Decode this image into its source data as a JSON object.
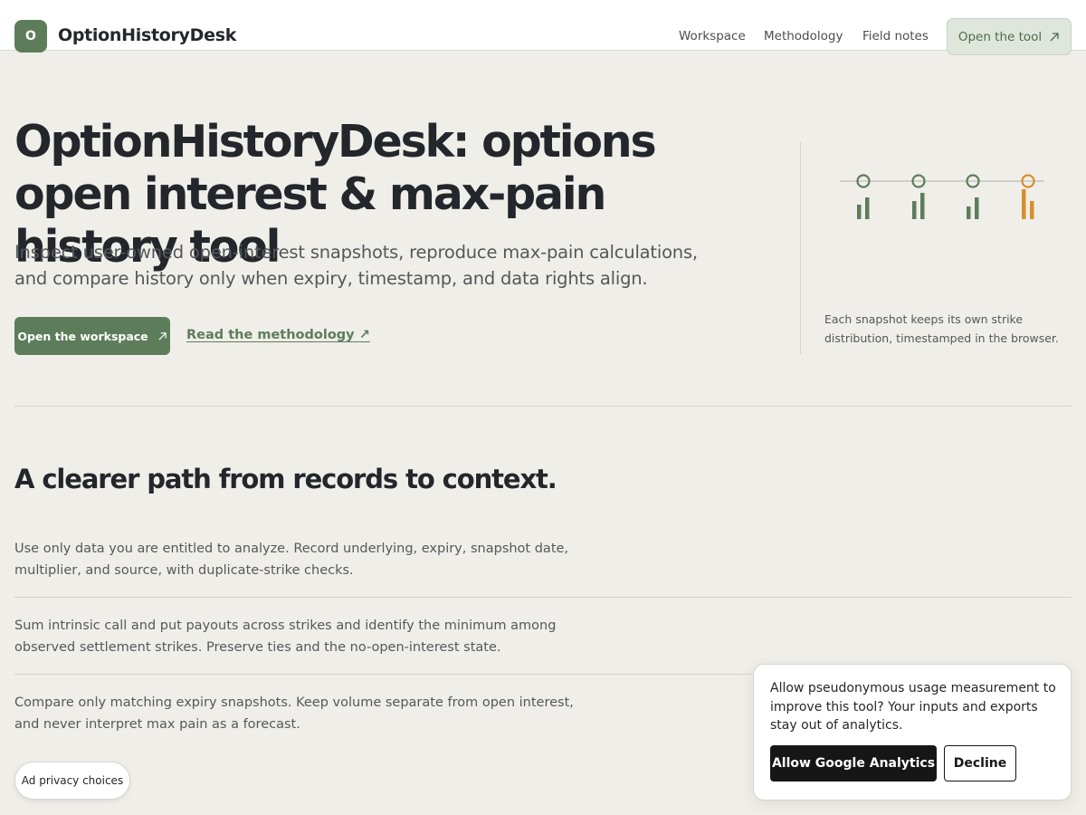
{
  "header": {
    "logo_letter": "O",
    "brand": "OptionHistoryDesk",
    "nav": [
      "Workspace",
      "Methodology",
      "Field notes"
    ],
    "cta_label": "Open the tool",
    "cta_icon": "arrow-up-right-icon"
  },
  "hero": {
    "title": "OptionHistoryDesk: options open interest & max-pain history tool",
    "subtitle": "Inspect user-owned open-interest snapshots, reproduce max-pain calculations, and compare history only when expiry, timestamp, and data rights align.",
    "primary_button": "Open the workspace",
    "secondary_link": "Read the methodology",
    "link_icon": "arrow-up-right-icon",
    "illustration_caption": "Each snapshot keeps its own strike distribution, timestamped in the browser."
  },
  "colors": {
    "accent": "#5d7d5a",
    "highlight": "#d98e2b",
    "background": "#efeee9"
  },
  "section": {
    "title": "A clearer path from records to context.",
    "rows": [
      "Use only data you are entitled to analyze. Record underlying, expiry, snapshot date, multiplier, and source, with duplicate-strike checks.",
      "Sum intrinsic call and put payouts across strikes and identify the minimum among observed settlement strikes. Preserve ties and the no-open-interest state.",
      "Compare only matching expiry snapshots. Keep volume separate from open interest, and never interpret max pain as a forecast."
    ]
  },
  "consent": {
    "text": "Allow pseudonymous usage measurement to improve this tool? Your inputs and exports stay out of analytics.",
    "allow_label": "Allow Google Analytics",
    "decline_label": "Decline"
  },
  "ad_privacy_label": "Ad privacy choices"
}
